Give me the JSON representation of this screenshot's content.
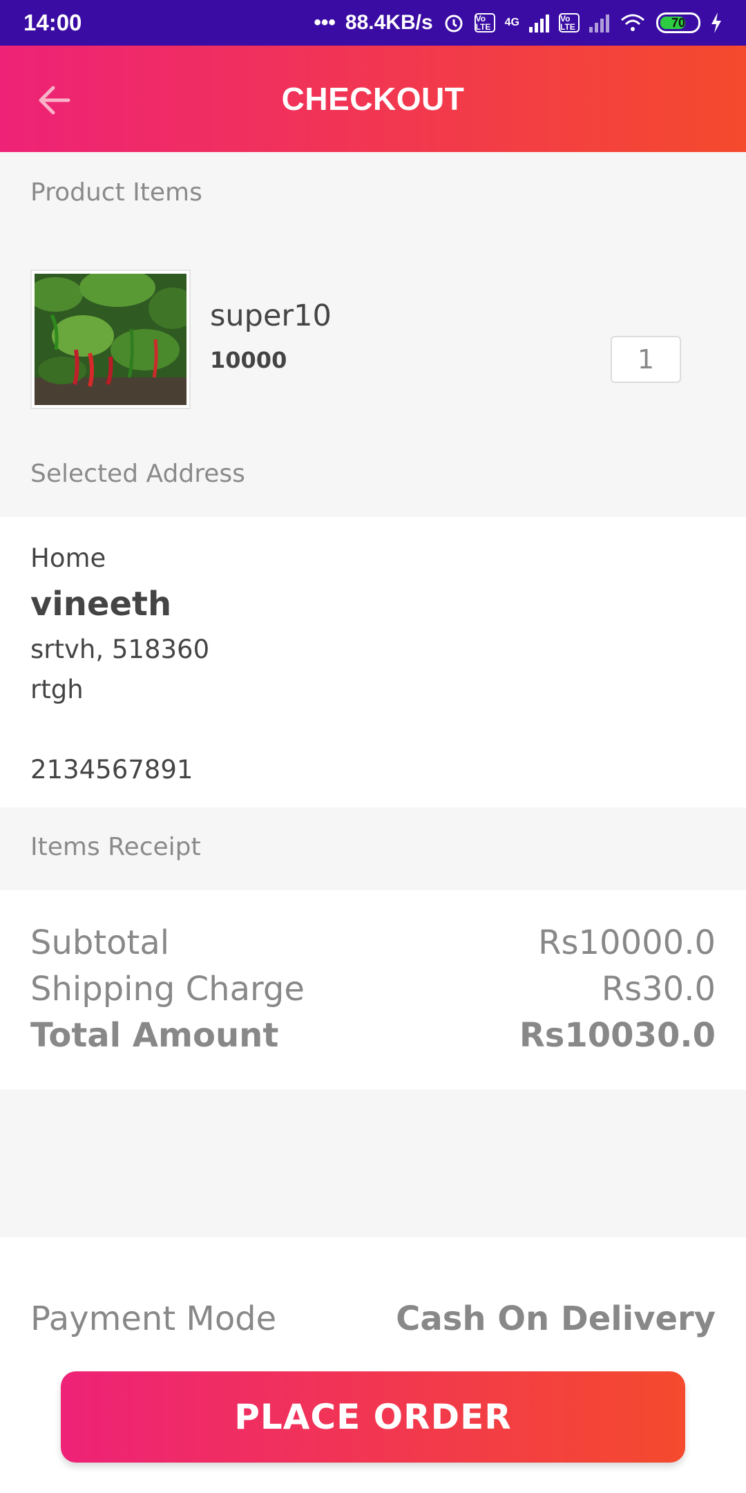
{
  "status_bar": {
    "time": "14:00",
    "net_speed": "88.4KB/s",
    "lte1": "Vo LTE",
    "lte2": "Vo LTE",
    "net_type": "4G",
    "battery": "70",
    "icons": [
      "alarm-icon",
      "signal-icon",
      "wifi-icon",
      "battery-icon",
      "charging-icon"
    ]
  },
  "app_bar": {
    "title": "CHECKOUT",
    "back_icon": "arrow-left-icon"
  },
  "product_section": {
    "label": "Product Items",
    "items": [
      {
        "name": "super10",
        "price": "10000",
        "quantity": "1"
      }
    ]
  },
  "address_section": {
    "label": "Selected Address",
    "type": "Home",
    "name": "vineeth",
    "line1": "srtvh, 518360",
    "line2": "rtgh",
    "phone": "2134567891"
  },
  "receipt_section": {
    "label": "Items Receipt",
    "rows": [
      {
        "label": "Subtotal",
        "value": "Rs10000.0"
      },
      {
        "label": "Shipping Charge",
        "value": "Rs30.0"
      },
      {
        "label": "Total Amount",
        "value": "Rs10030.0"
      }
    ]
  },
  "payment": {
    "label": "Payment Mode",
    "value": "Cash On Delivery"
  },
  "place_order_label": "PLACE ORDER",
  "colors": {
    "status_bar": "#3a0ca3",
    "gradient_start": "#ee2277",
    "gradient_end": "#f54a2d"
  }
}
